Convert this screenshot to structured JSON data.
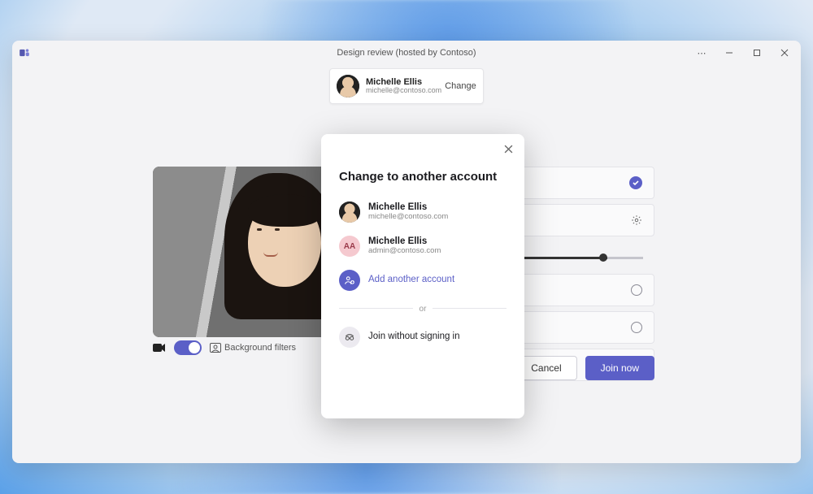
{
  "titlebar": {
    "title": "Design review (hosted by Contoso)"
  },
  "account_bar": {
    "name": "Michelle Ellis",
    "email": "michelle@contoso.com",
    "change_label": "Change"
  },
  "video_controls": {
    "background_filters_label": "Background filters"
  },
  "actions": {
    "cancel": "Cancel",
    "join": "Join now"
  },
  "modal": {
    "title": "Change to another account",
    "accounts": [
      {
        "name": "Michelle Ellis",
        "email": "michelle@contoso.com",
        "avatar_kind": "photo"
      },
      {
        "name": "Michelle Ellis",
        "email": "admin@contoso.com",
        "avatar_kind": "initials",
        "initials": "AA"
      }
    ],
    "add_label": "Add another account",
    "divider_label": "or",
    "anon_label": "Join without signing in"
  },
  "icons": {
    "app": "teams",
    "more": "⋯"
  }
}
